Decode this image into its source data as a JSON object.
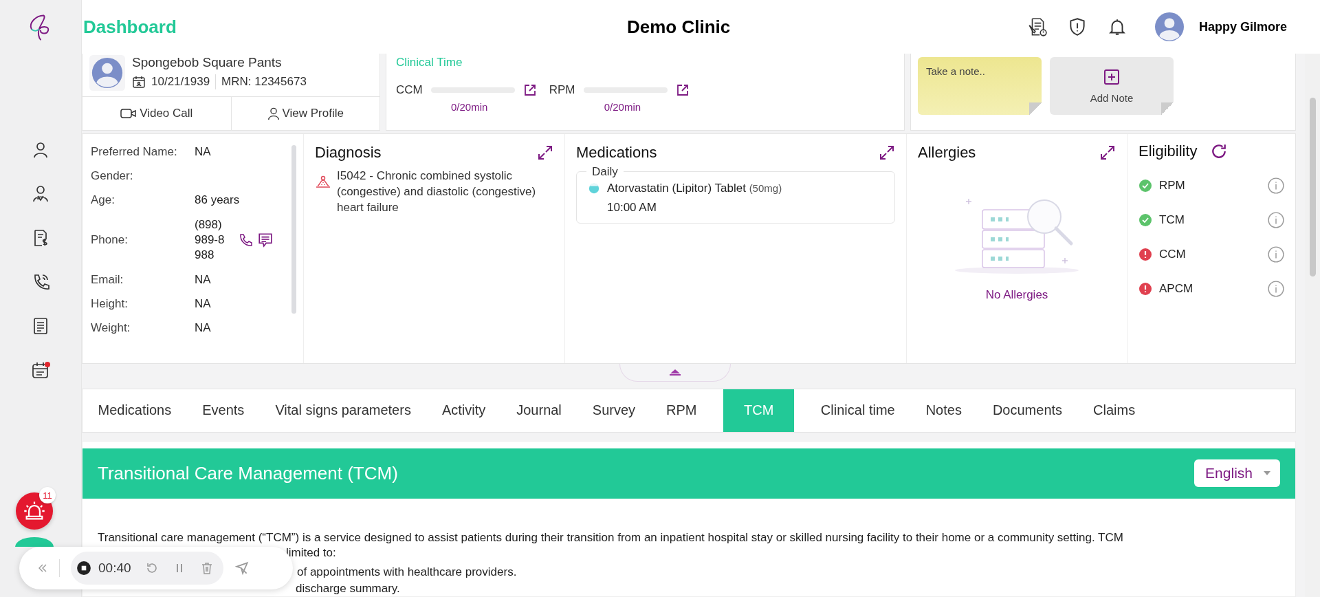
{
  "sidebar": {
    "items": [
      {
        "kind": "person",
        "dot": false
      },
      {
        "kind": "doctor",
        "dot": false
      },
      {
        "kind": "billing",
        "dot": false
      },
      {
        "kind": "phone",
        "dot": false
      },
      {
        "kind": "list",
        "dot": false
      },
      {
        "kind": "calendar",
        "dot": true
      }
    ]
  },
  "header": {
    "title": "Dashboard",
    "clinic": "Demo Clinic",
    "user": "Happy Gilmore"
  },
  "patient": {
    "name": "Spongebob Square Pants",
    "dob": "10/21/1939",
    "mrn": "MRN: 12345673",
    "actions": [
      {
        "kind": "video",
        "label": "Video Call"
      },
      {
        "kind": "profile",
        "label": "View Profile"
      }
    ]
  },
  "clinical_time": {
    "title": "Clinical Time",
    "meters": [
      {
        "label": "CCM",
        "level": 0,
        "reading": "0/20min"
      },
      {
        "label": "RPM",
        "level": 0,
        "reading": "0/20min"
      }
    ]
  },
  "notes": {
    "sticky": "Take a note..",
    "add": "Add Note"
  },
  "info": [
    {
      "label": "Preferred Name:",
      "value": "NA"
    },
    {
      "label": "Gender:"
    },
    {
      "label": "Age:",
      "value": "86 years"
    },
    {
      "label": "Phone:",
      "value": "(898) 989-8988",
      "kind": "phone"
    },
    {
      "label": "Email:",
      "value": "NA"
    },
    {
      "label": "Height:",
      "value": "NA"
    },
    {
      "label": "Weight:",
      "value": "NA"
    }
  ],
  "diagnosis": {
    "title": "Diagnosis",
    "items": [
      "I5042 - Chronic combined systolic (congestive) and diastolic (congestive) heart failure"
    ]
  },
  "medications": {
    "title": "Medications",
    "groups": [
      {
        "label": "Daily",
        "items": [
          {
            "name": "Atorvastatin (Lipitor) Tablet",
            "dose": "(50mg)",
            "time": "10:00 AM"
          }
        ]
      }
    ]
  },
  "allergies": {
    "title": "Allergies",
    "empty": "No Allergies"
  },
  "eligibility": {
    "title": "Eligibility",
    "items": [
      {
        "label": "RPM",
        "eligible": true
      },
      {
        "label": "TCM",
        "eligible": true
      },
      {
        "label": "CCM",
        "eligible": false
      },
      {
        "label": "APCM",
        "eligible": false
      }
    ]
  },
  "tabs": [
    {
      "label": "Medications",
      "selected": false
    },
    {
      "label": "Events",
      "selected": false
    },
    {
      "label": "Vital signs parameters",
      "selected": false
    },
    {
      "label": "Activity",
      "selected": false
    },
    {
      "label": "Journal",
      "selected": false
    },
    {
      "label": "Survey",
      "selected": false
    },
    {
      "label": "RPM",
      "selected": false
    },
    {
      "label": "TCM",
      "selected": true
    },
    {
      "label": "Clinical time",
      "selected": false
    },
    {
      "label": "Notes",
      "selected": false
    },
    {
      "label": "Documents",
      "selected": false
    },
    {
      "label": "Claims",
      "selected": false
    }
  ],
  "tcm": {
    "title": "Transitional Care Management (TCM)",
    "language": "English",
    "intro": "Transitional care management (“TCM”) is a service designed to assist patients during their transition from an inpatient hospital stay or skilled nursing facility to their home or a community setting. TCM",
    "fragments": [
      "limited to:",
      "of appointments with healthcare providers."
    ],
    "last": "discharge summary."
  },
  "alerts": {
    "count": "11"
  },
  "recorder": {
    "time": "00:40"
  }
}
